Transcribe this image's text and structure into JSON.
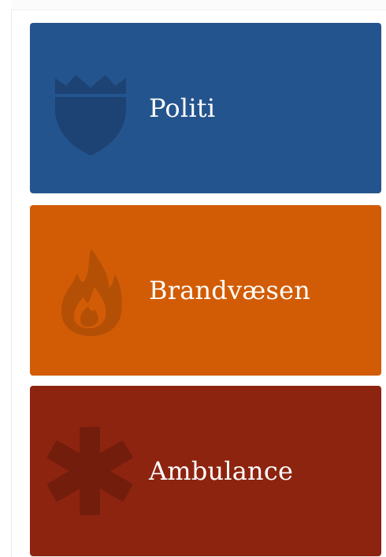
{
  "services": [
    {
      "label": "Politi",
      "color": "#24548d",
      "icon": "shield-icon"
    },
    {
      "label": "Brandvæsen",
      "color": "#d25c05",
      "icon": "flame-icon"
    },
    {
      "label": "Ambulance",
      "color": "#8d2410",
      "icon": "star-of-life-icon"
    }
  ]
}
